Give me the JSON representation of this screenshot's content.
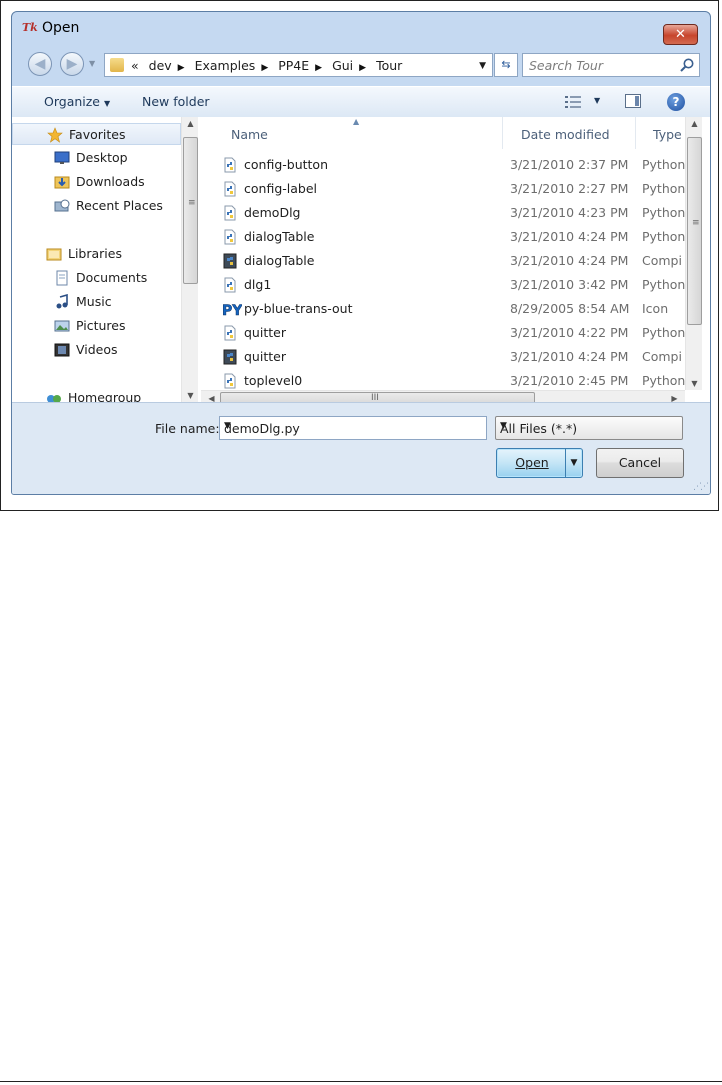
{
  "window": {
    "title": "Open",
    "app_icon": "tk-feather-icon"
  },
  "navigation": {
    "back_icon": "back-arrow-icon",
    "forward_icon": "forward-arrow-icon",
    "overflow": "«",
    "breadcrumbs": [
      "dev",
      "Examples",
      "PP4E",
      "Gui",
      "Tour"
    ],
    "search_placeholder": "Search Tour"
  },
  "toolbar": {
    "organize": "Organize",
    "new_folder": "New folder"
  },
  "nav_pane": {
    "items": [
      {
        "label": "Favorites",
        "icon": "star-icon",
        "level": 0,
        "selected": true
      },
      {
        "label": "Desktop",
        "icon": "desktop-icon",
        "level": 1
      },
      {
        "label": "Downloads",
        "icon": "downloads-icon",
        "level": 1
      },
      {
        "label": "Recent Places",
        "icon": "recent-places-icon",
        "level": 1
      },
      {
        "label": "Libraries",
        "icon": "libraries-icon",
        "level": 0
      },
      {
        "label": "Documents",
        "icon": "documents-icon",
        "level": 1
      },
      {
        "label": "Music",
        "icon": "music-icon",
        "level": 1
      },
      {
        "label": "Pictures",
        "icon": "pictures-icon",
        "level": 1
      },
      {
        "label": "Videos",
        "icon": "videos-icon",
        "level": 1
      },
      {
        "label": "Homegroup",
        "icon": "homegroup-icon",
        "level": 0
      }
    ]
  },
  "file_list": {
    "columns": [
      "Name",
      "Date modified",
      "Type"
    ],
    "rows": [
      {
        "name": "config-button",
        "date": "3/21/2010 2:37 PM",
        "type": "Python",
        "icon": "python-file-icon"
      },
      {
        "name": "config-label",
        "date": "3/21/2010 2:27 PM",
        "type": "Python",
        "icon": "python-file-icon"
      },
      {
        "name": "demoDlg",
        "date": "3/21/2010 4:23 PM",
        "type": "Python",
        "icon": "python-file-icon"
      },
      {
        "name": "dialogTable",
        "date": "3/21/2010 4:24 PM",
        "type": "Python",
        "icon": "python-file-icon"
      },
      {
        "name": "dialogTable",
        "date": "3/21/2010 4:24 PM",
        "type": "Compi",
        "icon": "compiled-python-icon"
      },
      {
        "name": "dlg1",
        "date": "3/21/2010 3:42 PM",
        "type": "Python",
        "icon": "python-file-icon"
      },
      {
        "name": "py-blue-trans-out",
        "date": "8/29/2005 8:54 AM",
        "type": "Icon",
        "icon": "py-logo-icon"
      },
      {
        "name": "quitter",
        "date": "3/21/2010 4:22 PM",
        "type": "Python",
        "icon": "python-file-icon"
      },
      {
        "name": "quitter",
        "date": "3/21/2010 4:24 PM",
        "type": "Compi",
        "icon": "compiled-python-icon"
      },
      {
        "name": "toplevel0",
        "date": "3/21/2010 2:45 PM",
        "type": "Python",
        "icon": "python-file-icon"
      }
    ]
  },
  "bottom": {
    "file_name_label": "File name:",
    "file_name_value": "demoDlg.py",
    "file_type_value": "All Files (*.*)",
    "open_label": "Open",
    "cancel_label": "Cancel"
  }
}
